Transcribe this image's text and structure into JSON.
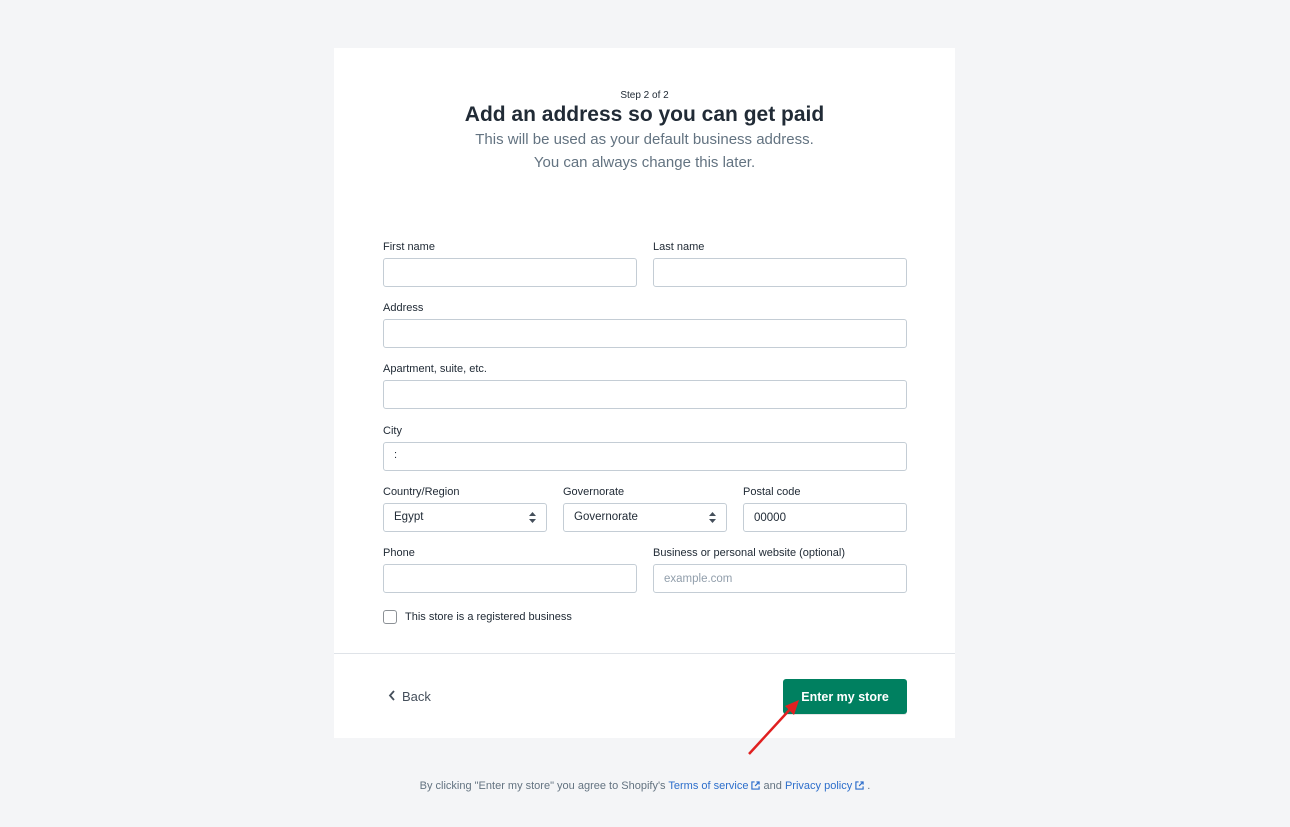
{
  "header": {
    "step": "Step 2 of 2",
    "title": "Add an address so you can get paid",
    "subtitle_line1": "This will be used as your default business address.",
    "subtitle_line2": "You can always change this later."
  },
  "form": {
    "first_name": {
      "label": "First name",
      "value": ""
    },
    "last_name": {
      "label": "Last name",
      "value": ""
    },
    "address": {
      "label": "Address",
      "value": ""
    },
    "apartment": {
      "label": "Apartment, suite, etc.",
      "value": ""
    },
    "city": {
      "label": "City",
      "value": ":"
    },
    "country": {
      "label": "Country/Region",
      "selected": "Egypt"
    },
    "governorate": {
      "label": "Governorate",
      "selected": "Governorate"
    },
    "postal_code": {
      "label": "Postal code",
      "value": "00000"
    },
    "phone": {
      "label": "Phone",
      "value": ""
    },
    "website": {
      "label": "Business or personal website (optional)",
      "placeholder": "example.com"
    },
    "registered_business": {
      "label": "This store is a registered business",
      "checked": false
    }
  },
  "actions": {
    "back_label": "Back",
    "enter_label": "Enter my store",
    "enter_color": "#008060"
  },
  "footer": {
    "prefix": "By clicking \"Enter my store\" you agree to Shopify's",
    "terms": "Terms of service",
    "and": "and",
    "privacy": "Privacy policy",
    "suffix": "."
  },
  "annotation": {
    "arrow_color": "#e02020"
  }
}
